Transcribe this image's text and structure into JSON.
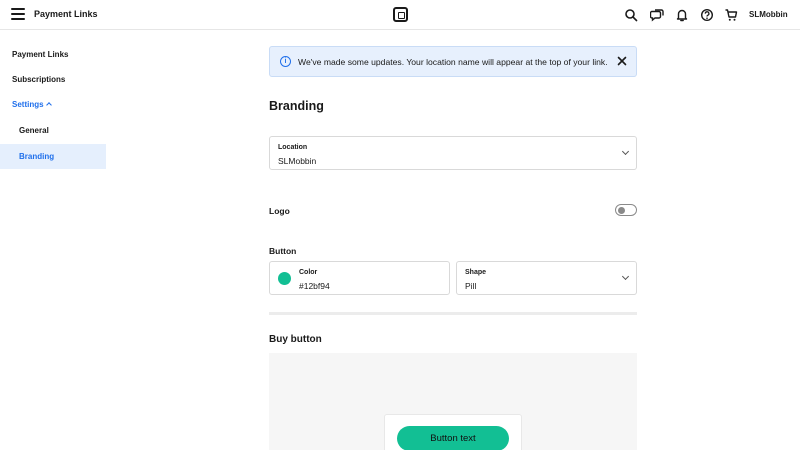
{
  "header": {
    "app_title": "Payment Links",
    "username": "SLMobbin",
    "icons": [
      "menu-icon",
      "square-logo-icon",
      "search-icon",
      "chat-icon",
      "bell-icon",
      "help-icon",
      "cart-icon"
    ]
  },
  "sidebar": {
    "items": [
      {
        "label": "Payment Links"
      },
      {
        "label": "Subscriptions"
      },
      {
        "label": "Settings"
      },
      {
        "label": "General"
      },
      {
        "label": "Branding"
      }
    ]
  },
  "banner": {
    "text": "We've made some updates. Your location name will appear at the top of your link."
  },
  "main": {
    "title": "Branding",
    "location": {
      "label": "Location",
      "value": "SLMobbin"
    },
    "logo": {
      "label": "Logo",
      "enabled": false
    },
    "button": {
      "section_label": "Button",
      "color_label": "Color",
      "color_value": "#12bf94",
      "shape_label": "Shape",
      "shape_value": "Pill"
    },
    "buy_button": {
      "title": "Buy button",
      "button_text": "Button text"
    }
  },
  "colors": {
    "accent": "#1f6feb",
    "button_color": "#12bf94",
    "banner_bg": "#e7f0fd"
  }
}
